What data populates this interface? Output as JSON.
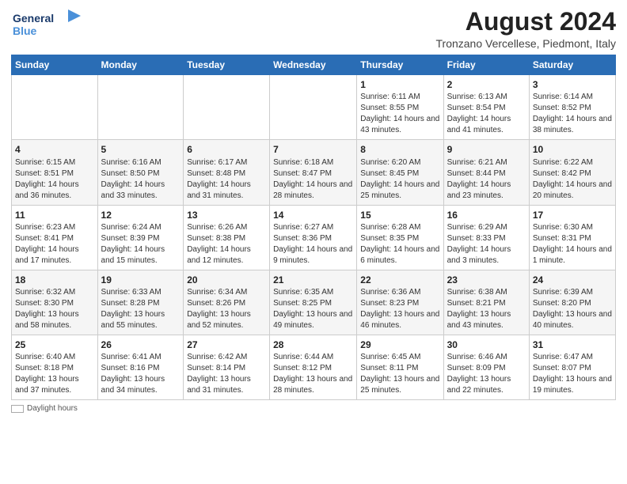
{
  "header": {
    "logo_line1": "General",
    "logo_line2": "Blue",
    "main_title": "August 2024",
    "subtitle": "Tronzano Vercellese, Piedmont, Italy"
  },
  "weekdays": [
    "Sunday",
    "Monday",
    "Tuesday",
    "Wednesday",
    "Thursday",
    "Friday",
    "Saturday"
  ],
  "weeks": [
    [
      {
        "day": "",
        "info": ""
      },
      {
        "day": "",
        "info": ""
      },
      {
        "day": "",
        "info": ""
      },
      {
        "day": "",
        "info": ""
      },
      {
        "day": "1",
        "info": "Sunrise: 6:11 AM\nSunset: 8:55 PM\nDaylight: 14 hours and 43 minutes."
      },
      {
        "day": "2",
        "info": "Sunrise: 6:13 AM\nSunset: 8:54 PM\nDaylight: 14 hours and 41 minutes."
      },
      {
        "day": "3",
        "info": "Sunrise: 6:14 AM\nSunset: 8:52 PM\nDaylight: 14 hours and 38 minutes."
      }
    ],
    [
      {
        "day": "4",
        "info": "Sunrise: 6:15 AM\nSunset: 8:51 PM\nDaylight: 14 hours and 36 minutes."
      },
      {
        "day": "5",
        "info": "Sunrise: 6:16 AM\nSunset: 8:50 PM\nDaylight: 14 hours and 33 minutes."
      },
      {
        "day": "6",
        "info": "Sunrise: 6:17 AM\nSunset: 8:48 PM\nDaylight: 14 hours and 31 minutes."
      },
      {
        "day": "7",
        "info": "Sunrise: 6:18 AM\nSunset: 8:47 PM\nDaylight: 14 hours and 28 minutes."
      },
      {
        "day": "8",
        "info": "Sunrise: 6:20 AM\nSunset: 8:45 PM\nDaylight: 14 hours and 25 minutes."
      },
      {
        "day": "9",
        "info": "Sunrise: 6:21 AM\nSunset: 8:44 PM\nDaylight: 14 hours and 23 minutes."
      },
      {
        "day": "10",
        "info": "Sunrise: 6:22 AM\nSunset: 8:42 PM\nDaylight: 14 hours and 20 minutes."
      }
    ],
    [
      {
        "day": "11",
        "info": "Sunrise: 6:23 AM\nSunset: 8:41 PM\nDaylight: 14 hours and 17 minutes."
      },
      {
        "day": "12",
        "info": "Sunrise: 6:24 AM\nSunset: 8:39 PM\nDaylight: 14 hours and 15 minutes."
      },
      {
        "day": "13",
        "info": "Sunrise: 6:26 AM\nSunset: 8:38 PM\nDaylight: 14 hours and 12 minutes."
      },
      {
        "day": "14",
        "info": "Sunrise: 6:27 AM\nSunset: 8:36 PM\nDaylight: 14 hours and 9 minutes."
      },
      {
        "day": "15",
        "info": "Sunrise: 6:28 AM\nSunset: 8:35 PM\nDaylight: 14 hours and 6 minutes."
      },
      {
        "day": "16",
        "info": "Sunrise: 6:29 AM\nSunset: 8:33 PM\nDaylight: 14 hours and 3 minutes."
      },
      {
        "day": "17",
        "info": "Sunrise: 6:30 AM\nSunset: 8:31 PM\nDaylight: 14 hours and 1 minute."
      }
    ],
    [
      {
        "day": "18",
        "info": "Sunrise: 6:32 AM\nSunset: 8:30 PM\nDaylight: 13 hours and 58 minutes."
      },
      {
        "day": "19",
        "info": "Sunrise: 6:33 AM\nSunset: 8:28 PM\nDaylight: 13 hours and 55 minutes."
      },
      {
        "day": "20",
        "info": "Sunrise: 6:34 AM\nSunset: 8:26 PM\nDaylight: 13 hours and 52 minutes."
      },
      {
        "day": "21",
        "info": "Sunrise: 6:35 AM\nSunset: 8:25 PM\nDaylight: 13 hours and 49 minutes."
      },
      {
        "day": "22",
        "info": "Sunrise: 6:36 AM\nSunset: 8:23 PM\nDaylight: 13 hours and 46 minutes."
      },
      {
        "day": "23",
        "info": "Sunrise: 6:38 AM\nSunset: 8:21 PM\nDaylight: 13 hours and 43 minutes."
      },
      {
        "day": "24",
        "info": "Sunrise: 6:39 AM\nSunset: 8:20 PM\nDaylight: 13 hours and 40 minutes."
      }
    ],
    [
      {
        "day": "25",
        "info": "Sunrise: 6:40 AM\nSunset: 8:18 PM\nDaylight: 13 hours and 37 minutes."
      },
      {
        "day": "26",
        "info": "Sunrise: 6:41 AM\nSunset: 8:16 PM\nDaylight: 13 hours and 34 minutes."
      },
      {
        "day": "27",
        "info": "Sunrise: 6:42 AM\nSunset: 8:14 PM\nDaylight: 13 hours and 31 minutes."
      },
      {
        "day": "28",
        "info": "Sunrise: 6:44 AM\nSunset: 8:12 PM\nDaylight: 13 hours and 28 minutes."
      },
      {
        "day": "29",
        "info": "Sunrise: 6:45 AM\nSunset: 8:11 PM\nDaylight: 13 hours and 25 minutes."
      },
      {
        "day": "30",
        "info": "Sunrise: 6:46 AM\nSunset: 8:09 PM\nDaylight: 13 hours and 22 minutes."
      },
      {
        "day": "31",
        "info": "Sunrise: 6:47 AM\nSunset: 8:07 PM\nDaylight: 13 hours and 19 minutes."
      }
    ]
  ],
  "legend": {
    "label": "Daylight hours"
  }
}
